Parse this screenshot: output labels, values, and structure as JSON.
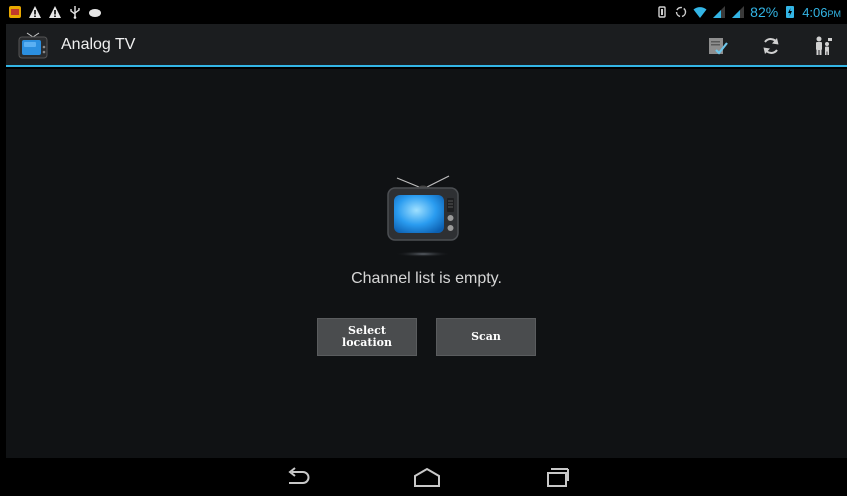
{
  "status_bar": {
    "left_icons": [
      "gallery-notification-icon",
      "warning-icon",
      "warning-icon",
      "usb-icon",
      "android-debug-icon"
    ],
    "right_icons": [
      "vibrate-icon",
      "data-sync-icon",
      "wifi-icon",
      "signal-icon",
      "signal-icon",
      "battery-charging-icon"
    ],
    "battery_percent": "82%",
    "time": "4:06",
    "ampm": "PM"
  },
  "action_bar": {
    "title": "Analog TV",
    "actions": [
      "edit-list-icon",
      "refresh-icon",
      "parental-control-icon"
    ]
  },
  "main": {
    "empty_message": "Channel list is empty.",
    "select_location_label": "Select location",
    "scan_label": "Scan"
  },
  "nav_bar": {
    "buttons": [
      "back-icon",
      "home-icon",
      "recent-apps-icon"
    ]
  },
  "colors": {
    "accent": "#33b5e5",
    "action_bar_bg": "#1b1d1f",
    "content_bg": "#101214",
    "button_bg": "#4a4c4e"
  }
}
